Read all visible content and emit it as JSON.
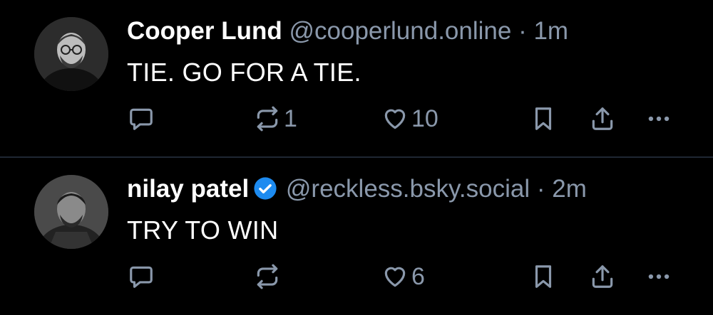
{
  "posts": [
    {
      "author_name": "Cooper Lund",
      "handle": "@cooperlund.online",
      "separator": "·",
      "time": "1m",
      "verified": false,
      "text": "TIE. GO FOR A TIE.",
      "reposts": "1",
      "likes": "10",
      "icons": [
        "reply-icon",
        "repost-icon",
        "like-icon",
        "bookmark-icon",
        "share-icon",
        "more-icon"
      ]
    },
    {
      "author_name": "nilay patel",
      "handle": "@reckless.bsky.social",
      "separator": "·",
      "time": "2m",
      "verified": true,
      "text": "TRY TO WIN",
      "reposts": "",
      "likes": "6",
      "icons": [
        "reply-icon",
        "repost-icon",
        "like-icon",
        "bookmark-icon",
        "share-icon",
        "more-icon"
      ]
    }
  ],
  "colors": {
    "background": "#000000",
    "text_primary": "#ffffff",
    "text_secondary": "#8a98ab",
    "divider": "#1f2733",
    "verified_badge": "#1d8bf0"
  }
}
